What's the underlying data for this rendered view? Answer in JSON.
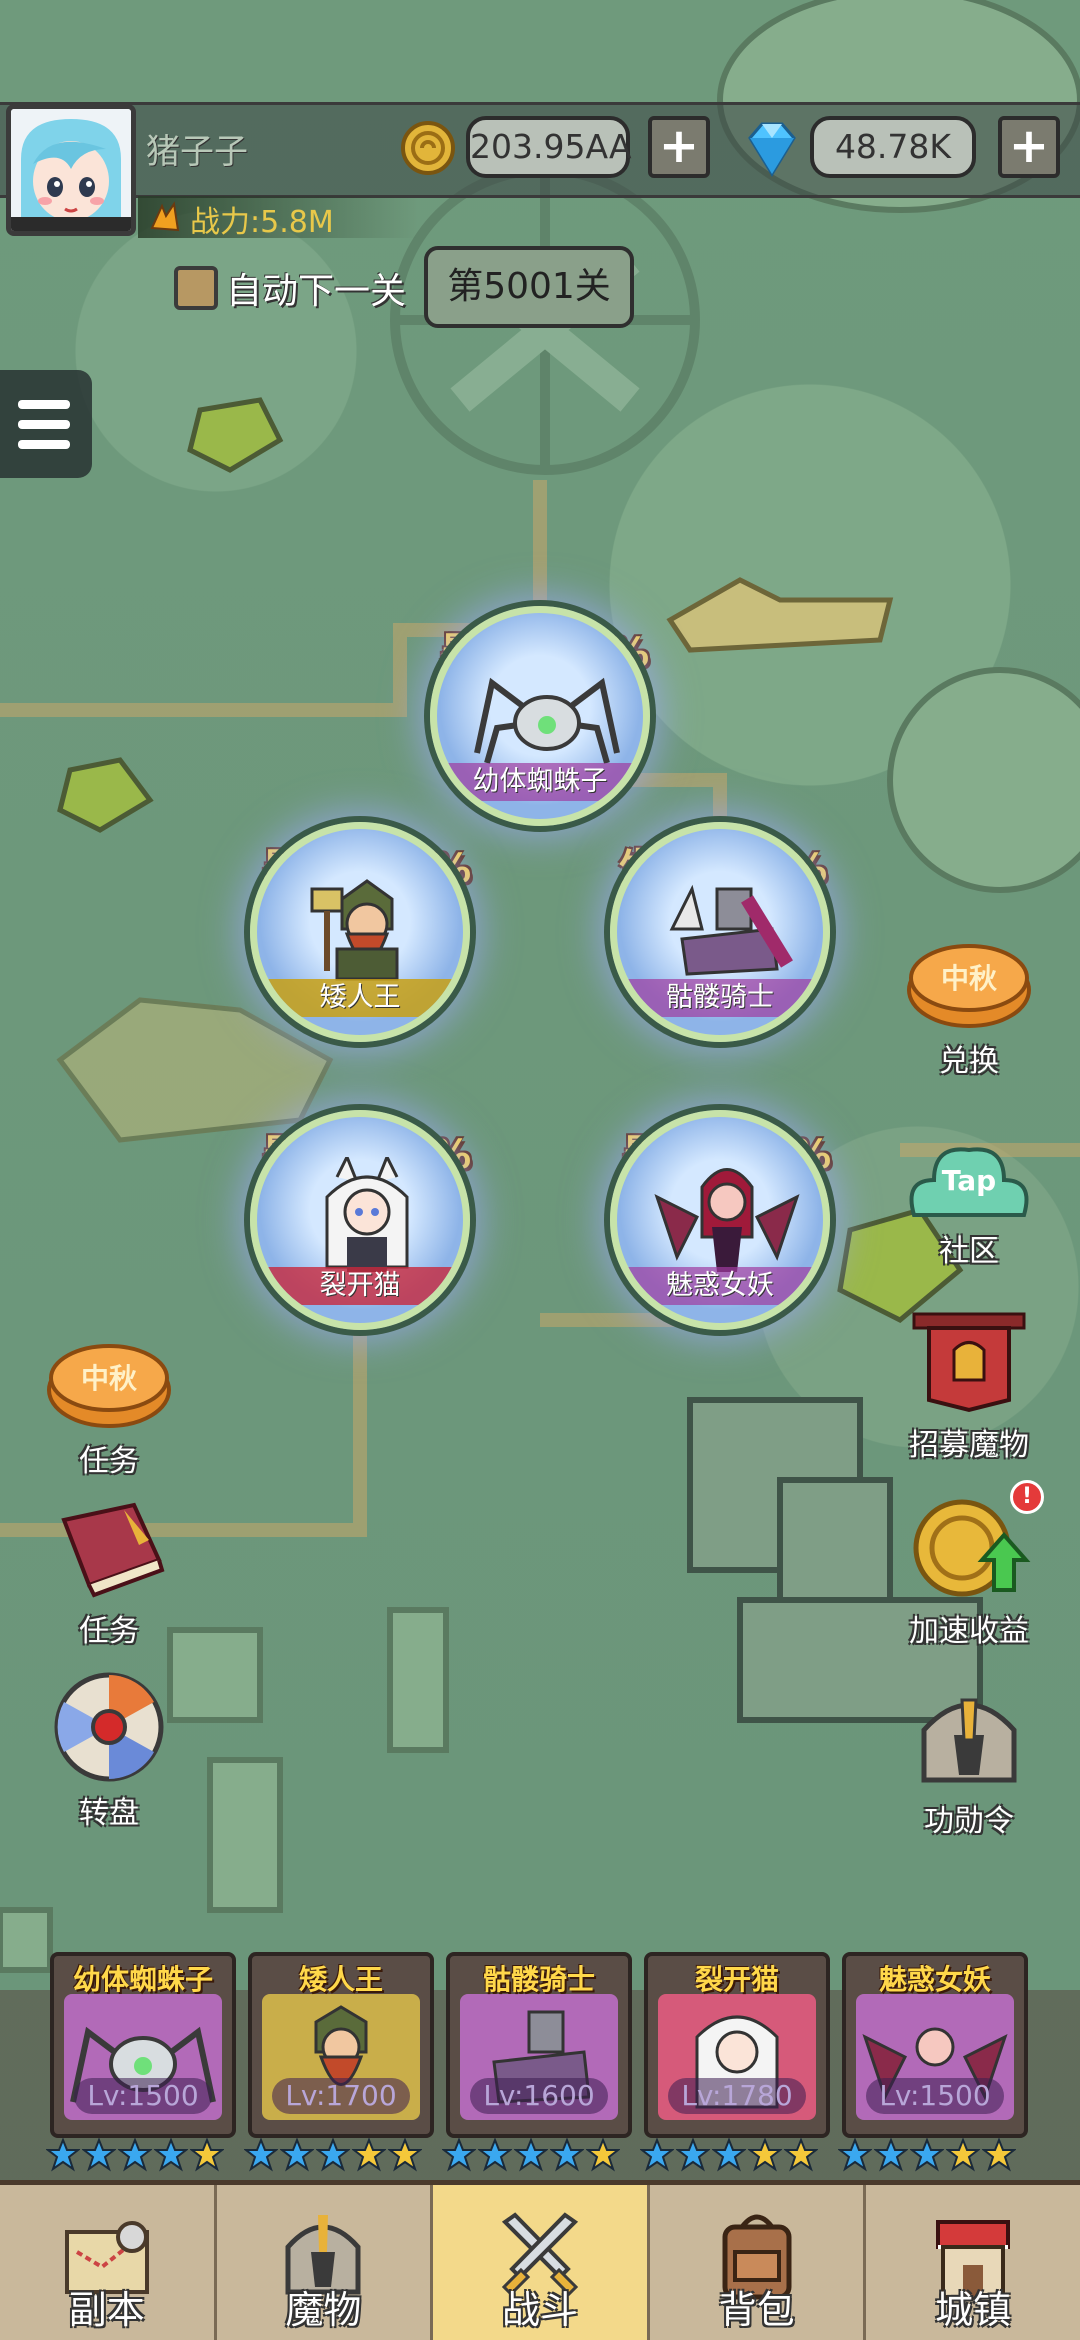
{
  "player": {
    "name": "猪子子",
    "power": "战力:5.8M"
  },
  "currency": {
    "gold": "203.95AA",
    "gems": "48.78K",
    "plus": "+"
  },
  "stage": {
    "auto_next_label": "自动下一关",
    "auto_next_checked": false,
    "current_stage": "第5001关"
  },
  "formation": [
    {
      "name": "幼体蜘蛛子",
      "bonus": "暴击+17%"
    },
    {
      "name": "矮人王",
      "bonus": "暴击+17%"
    },
    {
      "name": "骷髅骑士",
      "bonus": "生命+28%"
    },
    {
      "name": "裂开猫",
      "bonus": "暴击+17%"
    },
    {
      "name": "魅惑女妖",
      "bonus": "暴击+17%"
    }
  ],
  "left_side": [
    {
      "label": "任务",
      "icon": "mooncake-icon",
      "badge_text": "中秋"
    },
    {
      "label": "任务",
      "icon": "quest-book-icon"
    },
    {
      "label": "转盘",
      "icon": "wheel-icon"
    }
  ],
  "right_side": [
    {
      "label": "兑换",
      "icon": "mooncake-icon",
      "badge_text": "中秋"
    },
    {
      "label": "社区",
      "icon": "taptap-icon",
      "badge_text": "Tap"
    },
    {
      "label": "招募魔物",
      "icon": "banner-icon"
    },
    {
      "label": "加速收益",
      "icon": "coin-boost-icon",
      "alert": "!"
    },
    {
      "label": "功勋令",
      "icon": "helmet-icon"
    }
  ],
  "team": [
    {
      "name": "幼体蜘蛛子",
      "level": "Lv:1500",
      "stars_blue": 4,
      "stars_gold": 1
    },
    {
      "name": "矮人王",
      "level": "Lv:1700",
      "stars_blue": 3,
      "stars_gold": 2
    },
    {
      "name": "骷髅骑士",
      "level": "Lv:1600",
      "stars_blue": 4,
      "stars_gold": 1
    },
    {
      "name": "裂开猫",
      "level": "Lv:1780",
      "stars_blue": 3,
      "stars_gold": 2
    },
    {
      "name": "魅惑女妖",
      "level": "Lv:1500",
      "stars_blue": 3,
      "stars_gold": 2
    }
  ],
  "nav": [
    {
      "label": "副本",
      "icon": "map-scroll-icon",
      "active": false
    },
    {
      "label": "魔物",
      "icon": "helmet-icon",
      "active": false
    },
    {
      "label": "战斗",
      "icon": "crossed-swords-icon",
      "active": true
    },
    {
      "label": "背包",
      "icon": "backpack-icon",
      "active": false
    },
    {
      "label": "城镇",
      "icon": "shop-icon",
      "active": false
    }
  ],
  "colors": {
    "map_green": "#6f9a7c",
    "bonus_gold": "#ffd84a",
    "nav_active": "#f3d98a",
    "nav_bg": "#c9b89b"
  }
}
